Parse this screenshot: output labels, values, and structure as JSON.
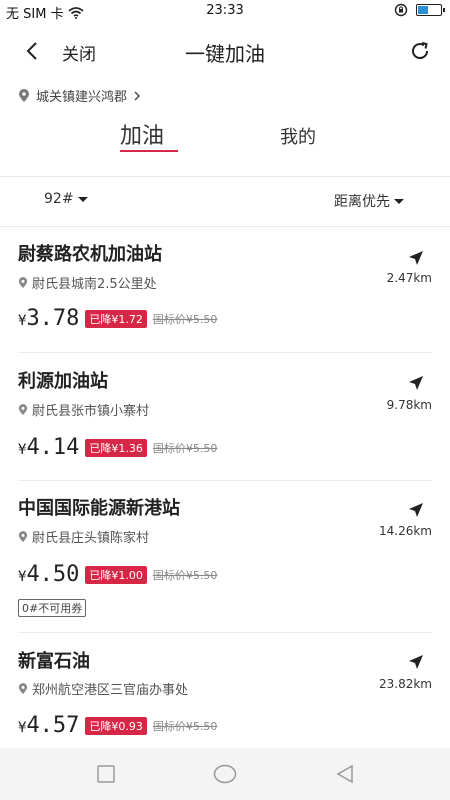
{
  "status_bar": {
    "carrier": "无 SIM 卡",
    "time": "23:33"
  },
  "nav": {
    "close_label": "关闭",
    "title": "一键加油"
  },
  "location": {
    "text": "城关镇建兴鸿郡"
  },
  "tabs": [
    {
      "label": "加油",
      "active": true
    },
    {
      "label": "我的",
      "active": false
    }
  ],
  "filter": {
    "fuel_type": "92#",
    "sort": "距离优先"
  },
  "stations": [
    {
      "name": "尉蔡路农机加油站",
      "address": "尉氏县城南2.5公里处",
      "distance": "2.47km",
      "price": "3.78",
      "discount": "已降¥1.72",
      "standard_price": "国标价¥5.50",
      "tag": ""
    },
    {
      "name": "利源加油站",
      "address": "尉氏县张市镇小寨村",
      "distance": "9.78km",
      "price": "4.14",
      "discount": "已降¥1.36",
      "standard_price": "国标价¥5.50",
      "tag": ""
    },
    {
      "name": "中国国际能源新港站",
      "address": "尉氏县庄头镇陈家村",
      "distance": "14.26km",
      "price": "4.50",
      "discount": "已降¥1.00",
      "standard_price": "国标价¥5.50",
      "tag": "0#不可用券"
    },
    {
      "name": "新富石油",
      "address": "郑州航空港区三官庙办事处",
      "distance": "23.82km",
      "price": "4.57",
      "discount": "已降¥0.93",
      "standard_price": "国标价¥5.50",
      "tag": ""
    }
  ],
  "currency_symbol": "¥",
  "colors": {
    "accent": "#d62747",
    "battery": "#2a8fd8"
  }
}
